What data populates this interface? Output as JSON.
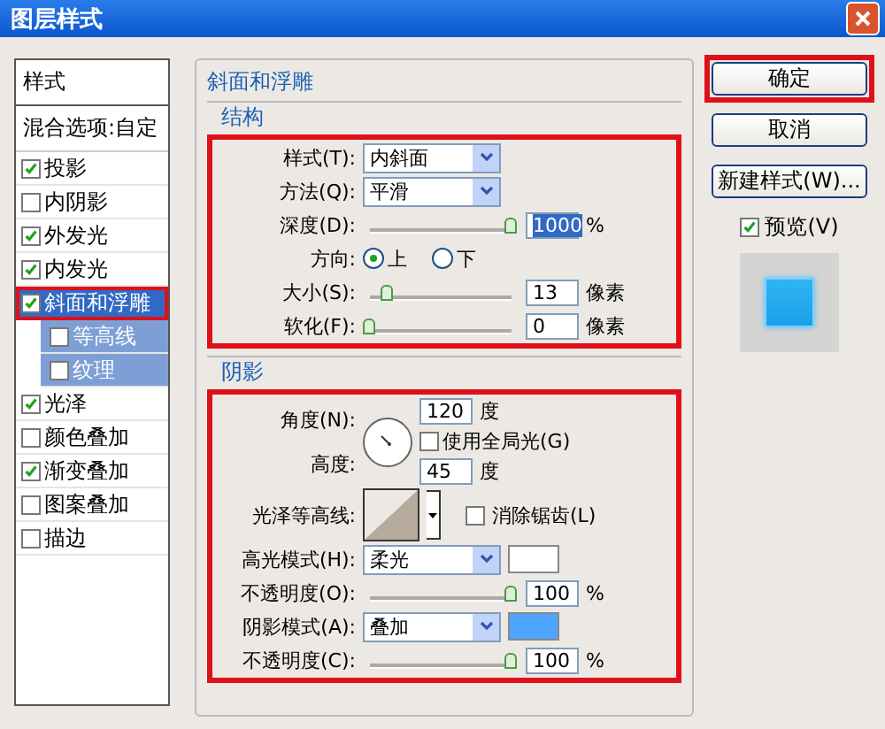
{
  "window": {
    "title": "图层样式"
  },
  "sidebar": {
    "header": "样式",
    "blend_options": "混合选项:自定",
    "items": [
      {
        "label": "投影",
        "checked": true,
        "selected": false,
        "highlighted": false
      },
      {
        "label": "内阴影",
        "checked": false,
        "selected": false,
        "highlighted": false
      },
      {
        "label": "外发光",
        "checked": true,
        "selected": false,
        "highlighted": false
      },
      {
        "label": "内发光",
        "checked": true,
        "selected": false,
        "highlighted": false
      },
      {
        "label": "斜面和浮雕",
        "checked": true,
        "selected": true,
        "highlighted": true,
        "children": [
          {
            "label": "等高线",
            "checked": false
          },
          {
            "label": "纹理",
            "checked": false
          }
        ]
      },
      {
        "label": "光泽",
        "checked": true,
        "selected": false,
        "highlighted": false
      },
      {
        "label": "颜色叠加",
        "checked": false,
        "selected": false,
        "highlighted": false
      },
      {
        "label": "渐变叠加",
        "checked": true,
        "selected": false,
        "highlighted": false
      },
      {
        "label": "图案叠加",
        "checked": false,
        "selected": false,
        "highlighted": false
      },
      {
        "label": "描边",
        "checked": false,
        "selected": false,
        "highlighted": false
      }
    ]
  },
  "panel": {
    "title": "斜面和浮雕",
    "structure": {
      "title": "结构",
      "highlighted": true,
      "rows": [
        {
          "kind": "select",
          "label": "样式(T):",
          "value": "内斜面"
        },
        {
          "kind": "select",
          "label": "方法(Q):",
          "value": "平滑"
        },
        {
          "kind": "slider",
          "label": "深度(D):",
          "level": 1,
          "value": "1000",
          "value_selected": true,
          "unit": "%"
        },
        {
          "kind": "radio",
          "label": "方向:",
          "options": [
            {
              "label": "上",
              "selected": true
            },
            {
              "label": "下",
              "selected": false
            }
          ]
        },
        {
          "kind": "slider",
          "label": "大小(S):",
          "level": 0.13,
          "value": "13",
          "value_selected": false,
          "unit": "像素"
        },
        {
          "kind": "slider",
          "label": "软化(F):",
          "level": 0,
          "value": "0",
          "value_selected": false,
          "unit": "像素"
        }
      ]
    },
    "shading": {
      "title": "阴影",
      "highlighted": true,
      "angle": {
        "label": "角度(N):",
        "value": "120",
        "unit": "度"
      },
      "global_light": {
        "label": "使用全局光(G)",
        "checked": false
      },
      "altitude": {
        "label": "高度:",
        "value": "45",
        "unit": "度"
      },
      "gloss_contour": {
        "label": "光泽等高线:",
        "anti_alias": {
          "label": "消除锯齿(L)",
          "checked": false
        }
      },
      "rows": [
        {
          "kind": "select",
          "label": "高光模式(H):",
          "value": "柔光",
          "color": "#ffffff"
        },
        {
          "kind": "slider",
          "label": "不透明度(O):",
          "level": 1,
          "value": "100",
          "value_selected": false,
          "unit": "%"
        },
        {
          "kind": "select",
          "label": "阴影模式(A):",
          "value": "叠加",
          "color": "#4da6ff"
        },
        {
          "kind": "slider",
          "label": "不透明度(C):",
          "level": 1,
          "value": "100",
          "value_selected": false,
          "unit": "%"
        }
      ]
    }
  },
  "buttons": [
    {
      "label": "确定",
      "highlighted": true
    },
    {
      "label": "取消",
      "highlighted": false
    },
    {
      "label": "新建样式(W)...",
      "highlighted": false
    }
  ],
  "preview": {
    "label": "预览(V)",
    "checked": true
  }
}
